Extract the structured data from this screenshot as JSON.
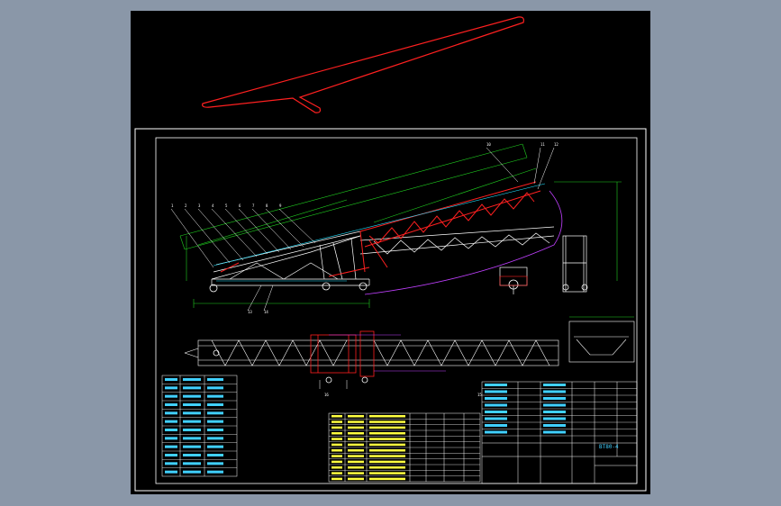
{
  "drawing": {
    "part_number": "BT80-4",
    "title_block": {
      "part_code": "BT80-4"
    },
    "leader_numbers": [
      "1",
      "2",
      "3",
      "4",
      "5",
      "6",
      "7",
      "8",
      "9",
      "10",
      "11",
      "12",
      "13",
      "14",
      "15",
      "16"
    ],
    "spec_table_rows": 12,
    "parts_list_rows": 12
  },
  "colors": {
    "background": "#8a97a8",
    "canvas": "#000000",
    "frame": "#ffffff",
    "structure": "#ffffff",
    "highlight": "#ff2020",
    "dimension": "#20d020",
    "text": "#ffff40",
    "table": "#ffffff",
    "table_text": "#40d0ff",
    "purple": "#c040ff",
    "cyan": "#20e0ff"
  }
}
